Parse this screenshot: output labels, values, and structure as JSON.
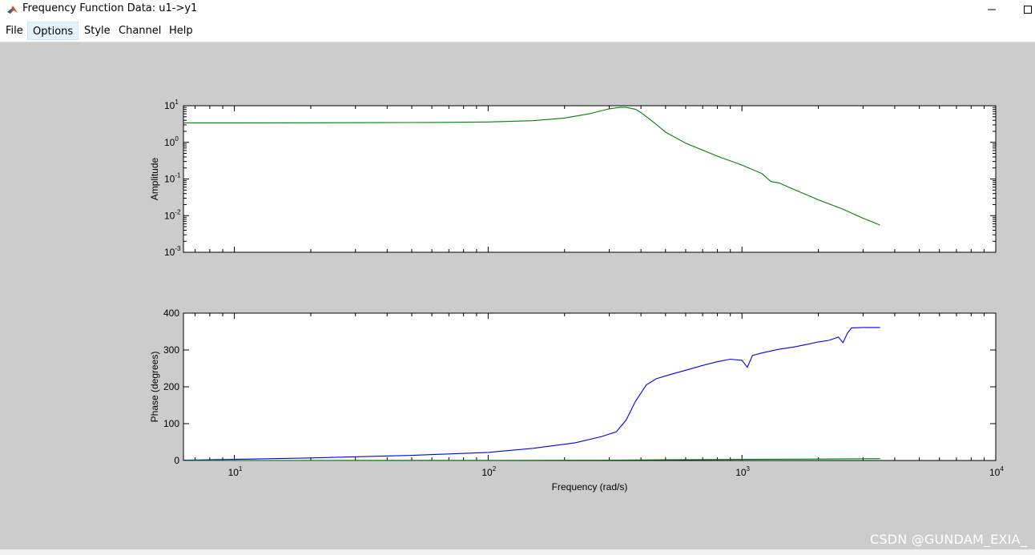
{
  "window": {
    "title": "Frequency Function Data: u1->y1",
    "minimize_icon": "minimize-icon",
    "maximize_icon": "maximize-icon"
  },
  "menu": {
    "items": [
      {
        "label": "File"
      },
      {
        "label": "Options"
      },
      {
        "label": "Style"
      },
      {
        "label": "Channel"
      },
      {
        "label": "Help"
      }
    ]
  },
  "watermark": "CSDN @GUNDAM_EXIA_",
  "colors": {
    "figure_bg": "#cccccc",
    "amplitude_line": "#008000",
    "phase_line_blue": "#0000ff",
    "phase_line_green": "#008000"
  },
  "chart_data": [
    {
      "type": "line",
      "title": "",
      "xlabel": "",
      "ylabel": "Amplitude",
      "xscale": "log",
      "yscale": "log",
      "xlim": [
        6.3,
        10000
      ],
      "ylim": [
        0.001,
        10
      ],
      "ytick_labels": [
        {
          "base": "10",
          "exp": "1"
        },
        {
          "base": "10",
          "exp": "0"
        },
        {
          "base": "10",
          "exp": "-1"
        },
        {
          "base": "10",
          "exp": "-2"
        },
        {
          "base": "10",
          "exp": "-3"
        }
      ],
      "grid": false,
      "series": [
        {
          "color": "#008000",
          "x": [
            6.3,
            10,
            20,
            40,
            60,
            100,
            150,
            200,
            250,
            300,
            330,
            350,
            380,
            400,
            450,
            500,
            600,
            800,
            1000,
            1200,
            1300,
            1400,
            1600,
            2000,
            2500,
            3000,
            3300,
            3500
          ],
          "y": [
            3.4,
            3.4,
            3.42,
            3.45,
            3.5,
            3.6,
            3.9,
            4.6,
            6.0,
            8.2,
            9.0,
            9.0,
            8.0,
            6.5,
            3.5,
            1.9,
            0.95,
            0.42,
            0.24,
            0.14,
            0.085,
            0.078,
            0.052,
            0.027,
            0.015,
            0.0085,
            0.0065,
            0.0055
          ]
        }
      ]
    },
    {
      "type": "line",
      "title": "",
      "xlabel": "Frequency (rad/s)",
      "ylabel": "Phase (degrees)",
      "xscale": "log",
      "yscale": "linear",
      "xlim": [
        6.3,
        10000
      ],
      "ylim": [
        0,
        400
      ],
      "yticks": [
        0,
        100,
        200,
        300,
        400
      ],
      "xtick_labels": [
        {
          "base": "10",
          "exp": "1"
        },
        {
          "base": "10",
          "exp": "2"
        },
        {
          "base": "10",
          "exp": "3"
        },
        {
          "base": "10",
          "exp": "4"
        }
      ],
      "grid": false,
      "series": [
        {
          "color": "#0000ff",
          "x": [
            6.3,
            10,
            20,
            50,
            100,
            150,
            220,
            280,
            320,
            350,
            380,
            420,
            460,
            520,
            600,
            700,
            800,
            900,
            1000,
            1050,
            1100,
            1200,
            1400,
            1600,
            1800,
            2000,
            2200,
            2400,
            2500,
            2600,
            2700,
            3000,
            3500
          ],
          "y": [
            1,
            3,
            7,
            14,
            22,
            33,
            48,
            65,
            78,
            110,
            160,
            205,
            222,
            233,
            245,
            258,
            268,
            275,
            272,
            253,
            285,
            292,
            302,
            308,
            315,
            322,
            326,
            335,
            320,
            345,
            360,
            361,
            361
          ]
        },
        {
          "color": "#008000",
          "x": [
            6.3,
            100,
            300,
            500,
            1000,
            2000,
            3500
          ],
          "y": [
            0,
            0.5,
            1,
            2,
            3,
            4,
            5
          ]
        }
      ]
    }
  ]
}
